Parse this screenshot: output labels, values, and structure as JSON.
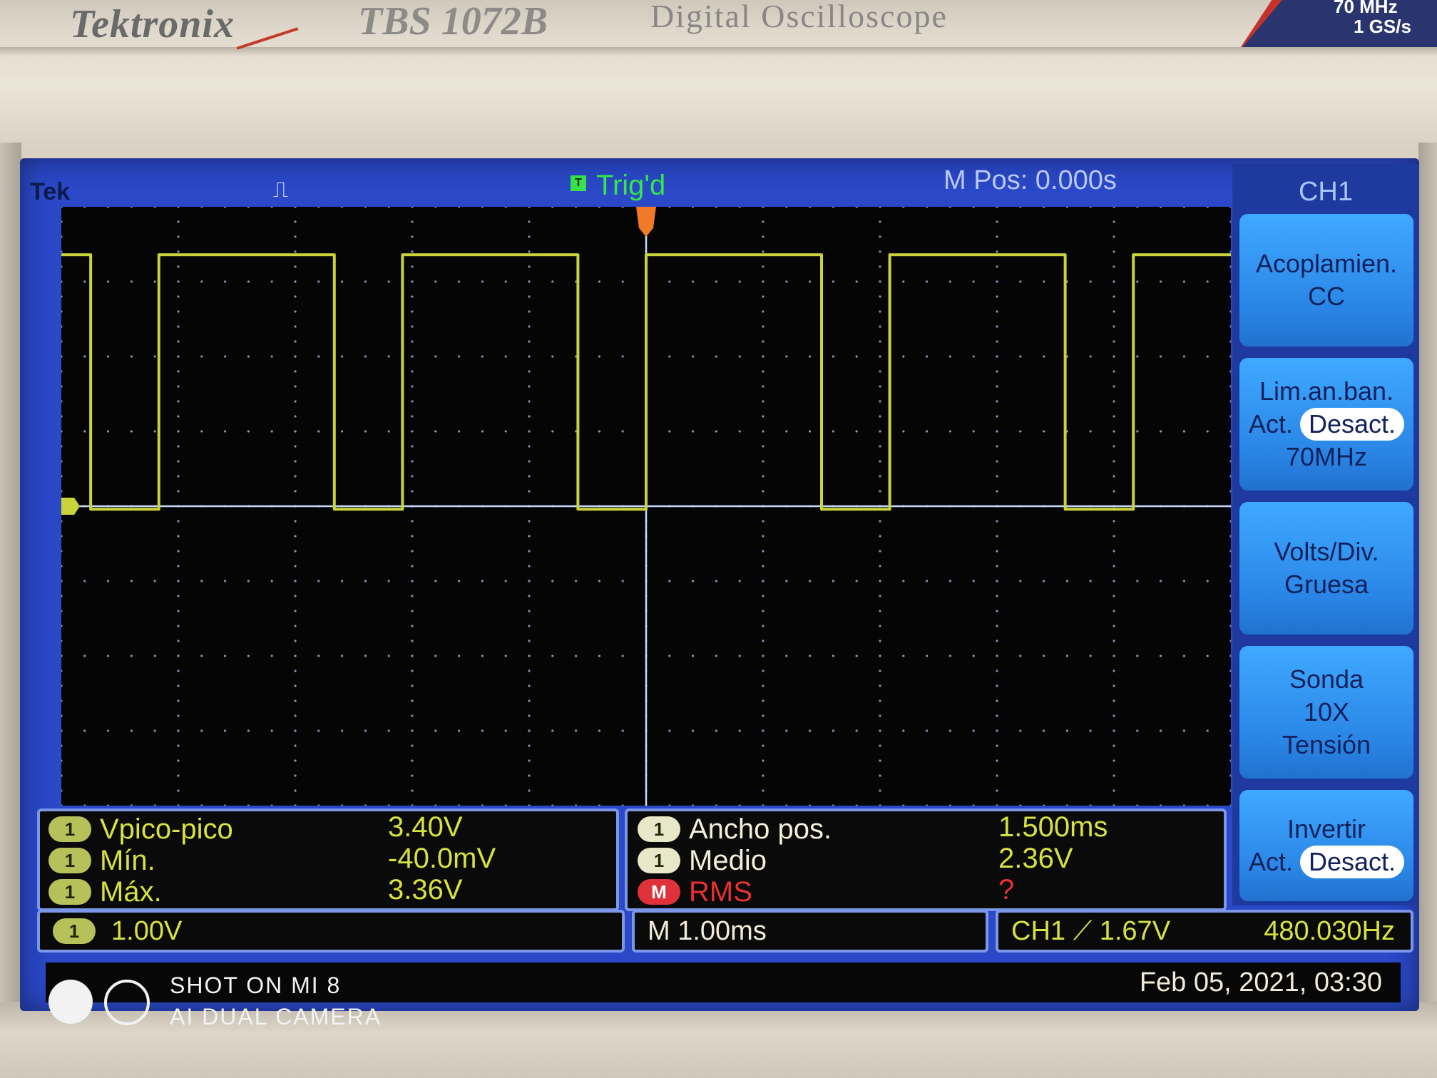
{
  "device": {
    "brand": "Tektronix",
    "model": "TBS 1072B",
    "product": "Digital Oscilloscope",
    "bandwidth": "70 MHz",
    "sample_rate": "1 GS/s"
  },
  "status": {
    "brand_short": "Tek",
    "acquisition_icon": "pulse-icon",
    "trigger_marker": "T",
    "trigger_state": "Trig'd",
    "horizontal_position": "M Pos: 0.000s"
  },
  "waveform": {
    "channel": "1",
    "high_level_v": 3.36,
    "low_level_v": -0.04,
    "volts_per_div": 1.0,
    "time_per_div_ms": 1.0,
    "visible_span_ms": [
      -5.0,
      5.0
    ],
    "pulse_width_ms": 1.5,
    "period_ms": 2.083,
    "color": "#c9d43a"
  },
  "menu": {
    "title": "CH1",
    "buttons": [
      {
        "line1": "Acoplamien.",
        "line2": "CC"
      },
      {
        "line1": "Lim.an.ban.",
        "opt_a": "Act.",
        "opt_b": "Desact.",
        "line3": "70MHz"
      },
      {
        "line1": "Volts/Div.",
        "line2": "Gruesa"
      },
      {
        "line1": "Sonda",
        "line2": "10X",
        "line3": "Tensión"
      },
      {
        "line1": "Invertir",
        "opt_a": "Act.",
        "opt_b": "Desact."
      }
    ]
  },
  "measurements": {
    "left": [
      {
        "source": "1",
        "label": "Vpico-pico",
        "value": "3.40V"
      },
      {
        "source": "1",
        "label": "Mín.",
        "value": "-40.0mV"
      },
      {
        "source": "1",
        "label": "Máx.",
        "value": "3.36V"
      }
    ],
    "right": [
      {
        "source": "1",
        "label": "Ancho pos.",
        "value": "1.500ms"
      },
      {
        "source": "1",
        "label": "Medio",
        "value": "2.36V"
      },
      {
        "source": "M",
        "label": "RMS",
        "value": "?"
      }
    ]
  },
  "bottom": {
    "ch1_badge": "1",
    "ch1_scale": "1.00V",
    "timebase": "M 1.00ms",
    "trigger": "CH1 ⟋ 1.67V",
    "frequency": "480.030Hz",
    "datetime": "Feb 05, 2021, 03:30"
  },
  "watermark": {
    "line1": "SHOT ON MI 8",
    "line2": "AI DUAL CAMERA"
  },
  "colors": {
    "screen_blue": "#2a48c7",
    "trace_yellow": "#c9d43a",
    "trig_green": "#38e04a",
    "menu_button": "#3fa9ff"
  }
}
